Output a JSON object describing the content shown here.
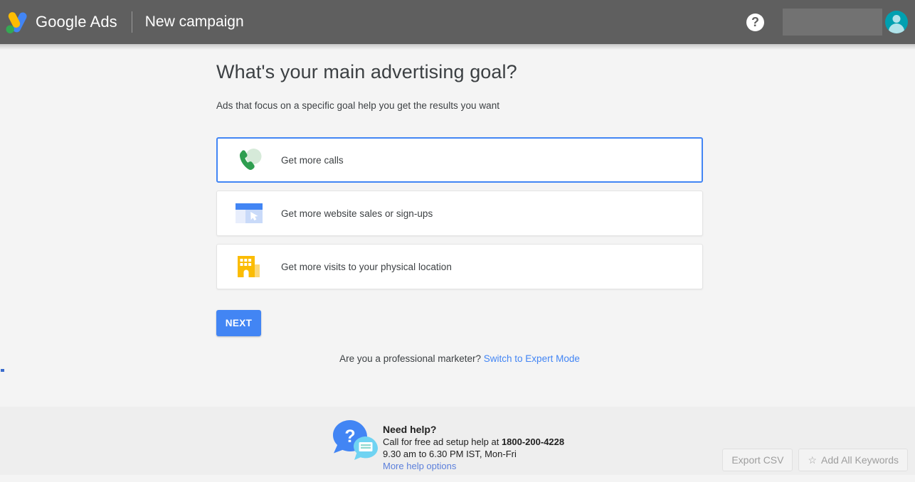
{
  "header": {
    "logo_icon": "google-ads-logo",
    "brand_google": "Google",
    "brand_ads": "Ads",
    "page_title": "New campaign",
    "help_icon_label": "?",
    "help_icon": "help-question-icon",
    "account_icon": "user-avatar-icon",
    "colors": {
      "bar": "#5f5f5f",
      "redacted": "#727272",
      "avatar": "#00a0b0"
    }
  },
  "main": {
    "headline": "What's your main advertising goal?",
    "subhead": "Ads that focus on a specific goal help you get the results you want",
    "goals": [
      {
        "label": "Get more calls",
        "icon": "phone-call-icon",
        "selected": true
      },
      {
        "label": "Get more website sales or sign-ups",
        "icon": "browser-window-cursor-icon",
        "selected": false
      },
      {
        "label": "Get more visits to your physical location",
        "icon": "store-building-icon",
        "selected": false
      }
    ],
    "next_label": "NEXT",
    "expert_question": "Are you a professional marketer?",
    "expert_link": "Switch to Expert Mode",
    "accent_color": "#4285f4"
  },
  "footer": {
    "icon": "help-speech-bubble-icon",
    "title": "Need help?",
    "call_prefix": "Call for free ad setup help at ",
    "phone": "1800-200-4228",
    "hours": "9.30 am to 6.30 PM IST, Mon-Fri",
    "more_link": "More help options"
  },
  "overlay": {
    "export_label": "Export CSV",
    "add_keywords_label": "Add All Keywords",
    "star_icon": "star-icon",
    "star_glyph": "☆"
  }
}
